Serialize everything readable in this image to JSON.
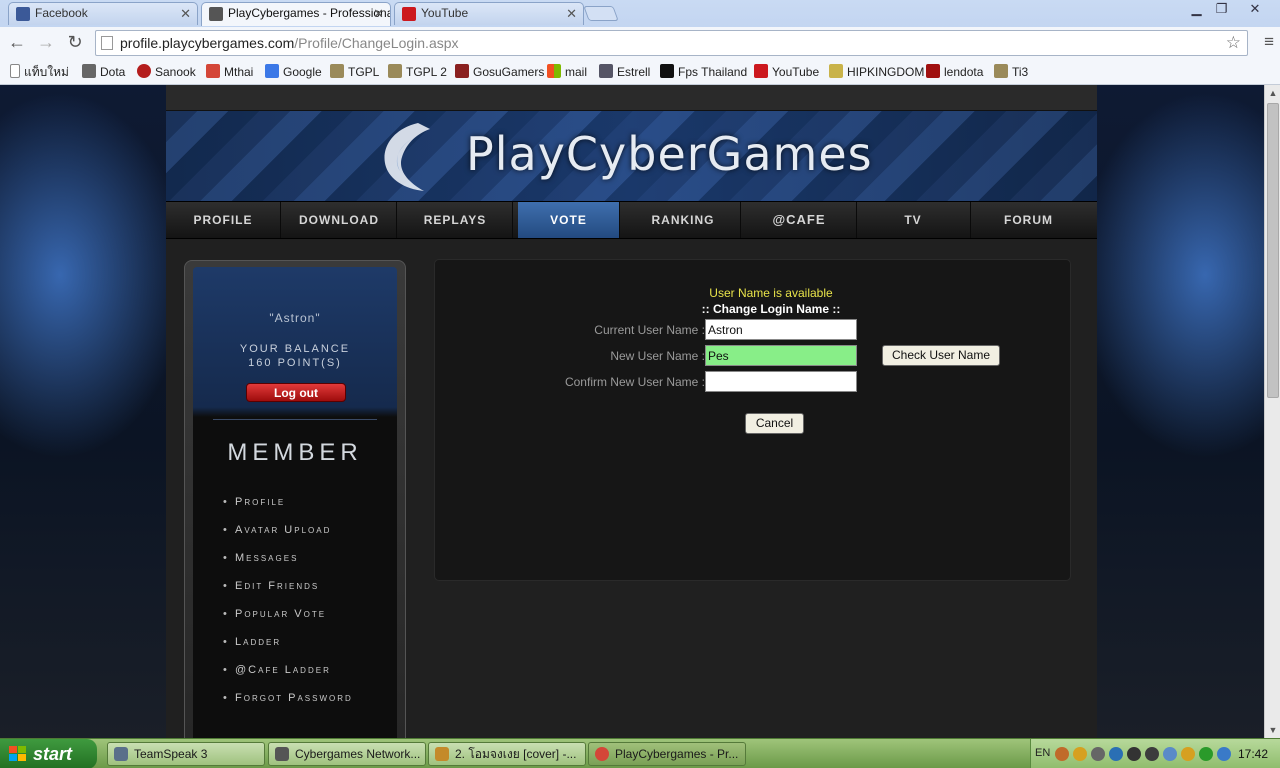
{
  "browser": {
    "tabs": [
      {
        "title": "Facebook",
        "active": false,
        "icon_color": "#3b5998"
      },
      {
        "title": "PlayCybergames - Professional",
        "active": true,
        "icon_color": "#555555"
      },
      {
        "title": "YouTube",
        "active": false,
        "icon_color": "#cc181e"
      }
    ],
    "url_host": "profile.playcybergames.com",
    "url_path": "/Profile/ChangeLogin.aspx",
    "bookmarks": [
      {
        "label": "แท็บใหม่",
        "icon": "page-icon"
      },
      {
        "label": "Dota",
        "icon": "cybergames-icon"
      },
      {
        "label": "Sanook",
        "icon": "sanook-icon"
      },
      {
        "label": "Mthai",
        "icon": "gmail-icon"
      },
      {
        "label": "Google",
        "icon": "google-icon"
      },
      {
        "label": "TGPL",
        "icon": "tgpl-icon"
      },
      {
        "label": "TGPL 2",
        "icon": "tgpl-icon"
      },
      {
        "label": "GosuGamers",
        "icon": "gosugamers-icon"
      },
      {
        "label": "mail",
        "icon": "windows-icon"
      },
      {
        "label": "Estrell",
        "icon": "estrell-icon"
      },
      {
        "label": "Fps Thailand",
        "icon": "fps-icon"
      },
      {
        "label": "YouTube",
        "icon": "youtube-icon"
      },
      {
        "label": "HIPKINGDOM",
        "icon": "hipkingdom-icon"
      },
      {
        "label": "lendota",
        "icon": "lendota-icon"
      },
      {
        "label": "Ti3",
        "icon": "tgpl-icon"
      }
    ]
  },
  "site": {
    "logo_text": "PlayCyberGames",
    "nav": [
      {
        "label": "PROFILE",
        "active": false
      },
      {
        "label": "DOWNLOAD",
        "active": false
      },
      {
        "label": "REPLAYS",
        "active": false
      },
      {
        "label": "VOTE",
        "active": true
      },
      {
        "label": "RANKING",
        "active": false
      },
      {
        "label": "@CAFE",
        "active": false
      },
      {
        "label": "TV",
        "active": false
      },
      {
        "label": "FORUM",
        "active": false
      }
    ],
    "sidebar": {
      "username": "\"Astron\"",
      "balance_label": "Your Balance",
      "balance_value": "160 Point(s)",
      "logout_label": "Log out",
      "section_title": "MEMBER",
      "menu": [
        "Profile",
        "Avatar Upload",
        "Messages",
        "Edit Friends",
        "Popular Vote",
        "Ladder",
        "@Cafe Ladder",
        "Forgot Password"
      ]
    },
    "form": {
      "status_message": "User Name is available",
      "title": ":: Change Login Name ::",
      "current_label": "Current User Name :",
      "current_value": "Astron",
      "new_label": "New User Name :",
      "new_value": "Pes",
      "confirm_label": "Confirm New User Name :",
      "confirm_value": "",
      "check_button": "Check User Name",
      "cancel_button": "Cancel"
    }
  },
  "taskbar": {
    "start_label": "start",
    "tasks": [
      {
        "label": "TeamSpeak 3",
        "icon_color": "#5a6f8a"
      },
      {
        "label": "Cybergames Network...",
        "icon_color": "#555555"
      },
      {
        "label": "2. โอมจงเงย [cover] -...",
        "icon_color": "#c48a2a"
      },
      {
        "label": "PlayCybergames - Pr...",
        "icon_color": "#d44638"
      }
    ],
    "lang": "EN",
    "clock": "17:42"
  }
}
